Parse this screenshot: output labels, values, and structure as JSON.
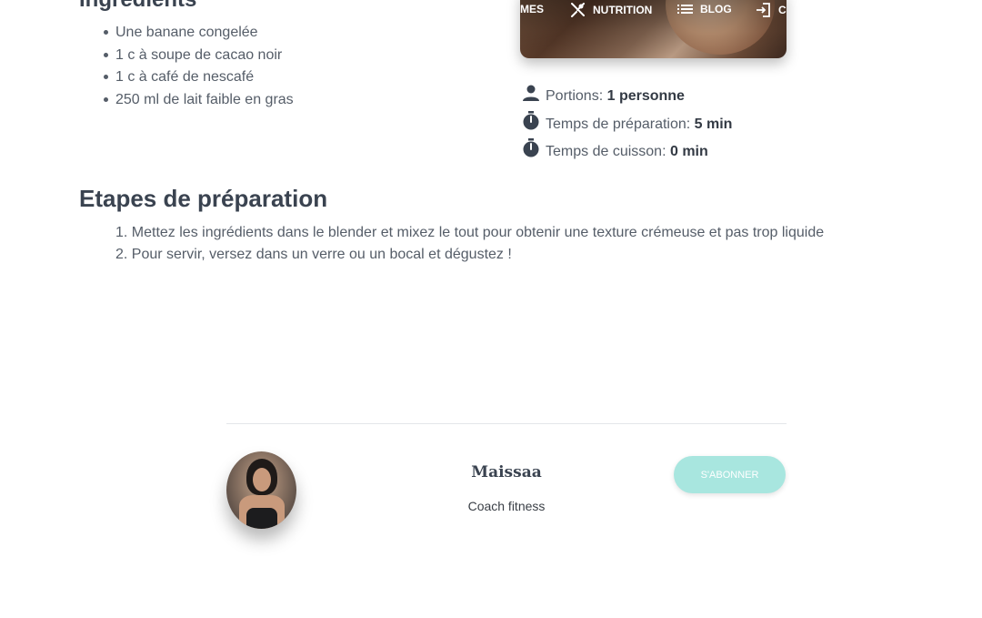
{
  "ingredients": {
    "title": "Ingrédients",
    "items": [
      "Une banane congelée",
      "1 c à soupe de cacao noir",
      "1 c à café de nescafé",
      "250 ml de lait faible en gras"
    ]
  },
  "nav": {
    "items": [
      {
        "label": "MES",
        "icon": "none"
      },
      {
        "label": "NUTRITION",
        "icon": "fork-knife-icon"
      },
      {
        "label": "BLOG",
        "icon": "list-icon"
      },
      {
        "label": "C",
        "icon": "login-icon"
      }
    ]
  },
  "meta": {
    "portions_label": "Portions:",
    "portions_value": "1 personne",
    "prep_label": "Temps de préparation:",
    "prep_value": "5 min",
    "cook_label": "Temps de cuisson:",
    "cook_value": "0 min"
  },
  "steps": {
    "title": "Etapes de préparation",
    "items": [
      "1. Mettez les ingrédients dans le blender et mixez le tout pour obtenir une texture crémeuse et pas trop liquide",
      "2. Pour servir, versez dans un verre ou un bocal et dégustez !"
    ]
  },
  "author": {
    "name": "Maissaa",
    "role": "Coach fitness",
    "subscribe_label": "S'ABONNER"
  },
  "colors": {
    "text": "#3a4350",
    "subscribe_bg": "#a8e6df"
  }
}
